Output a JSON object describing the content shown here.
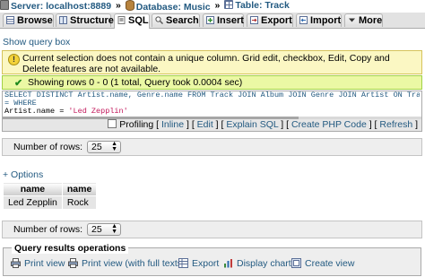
{
  "breadcrumb": {
    "server": "Server: localhost:8889",
    "database": "Database: Music",
    "table": "Table: Track",
    "separator": "»"
  },
  "tabs": [
    {
      "label": "Browse",
      "icon": "browse-icon",
      "active": false
    },
    {
      "label": "Structure",
      "icon": "structure-icon",
      "active": false
    },
    {
      "label": "SQL",
      "icon": "sql-icon",
      "active": true
    },
    {
      "label": "Search",
      "icon": "search-icon",
      "active": false
    },
    {
      "label": "Insert",
      "icon": "insert-icon",
      "active": false
    },
    {
      "label": "Export",
      "icon": "export-icon",
      "active": false
    },
    {
      "label": "Import",
      "icon": "import-icon",
      "active": false
    },
    {
      "label": "More",
      "icon": "chevron-down-icon",
      "active": false
    }
  ],
  "show_query_box": "Show query box",
  "notice": "Current selection does not contain a unique column. Grid edit, checkbox, Edit, Copy and Delete features are not available.",
  "success": "Showing rows 0 - 0 (1 total, Query took 0.0004 sec)",
  "sql": {
    "line1": "SELECT DISTINCT Artist.name, Genre.name FROM Track JOIN Album JOIN Genre JOIN Artist ON Track.album_id",
    "line2": "= WHERE",
    "line3_field": "Artist.name",
    "line3_op": " = ",
    "line3_value": "'Led Zepplin'"
  },
  "sql_tools": {
    "profiling": "Profiling",
    "inline": "Inline",
    "edit": "Edit",
    "explain": "Explain SQL",
    "create_php": "Create PHP Code",
    "refresh": "Refresh"
  },
  "rows_label": "Number of rows:",
  "rows_value": "25",
  "options": "+ Options",
  "results": {
    "headers": [
      "name",
      "name"
    ],
    "rows": [
      [
        "Led Zepplin",
        "Rock"
      ]
    ]
  },
  "query_ops": {
    "legend": "Query results operations",
    "print_view": "Print view",
    "print_view_full": "Print view (with full texts)",
    "export": "Export",
    "display_chart": "Display chart",
    "create_view": "Create view"
  },
  "colors": {
    "link": "#235a81",
    "notice_bg": "#fbf7c3",
    "success_bg": "#ebf8a4"
  }
}
